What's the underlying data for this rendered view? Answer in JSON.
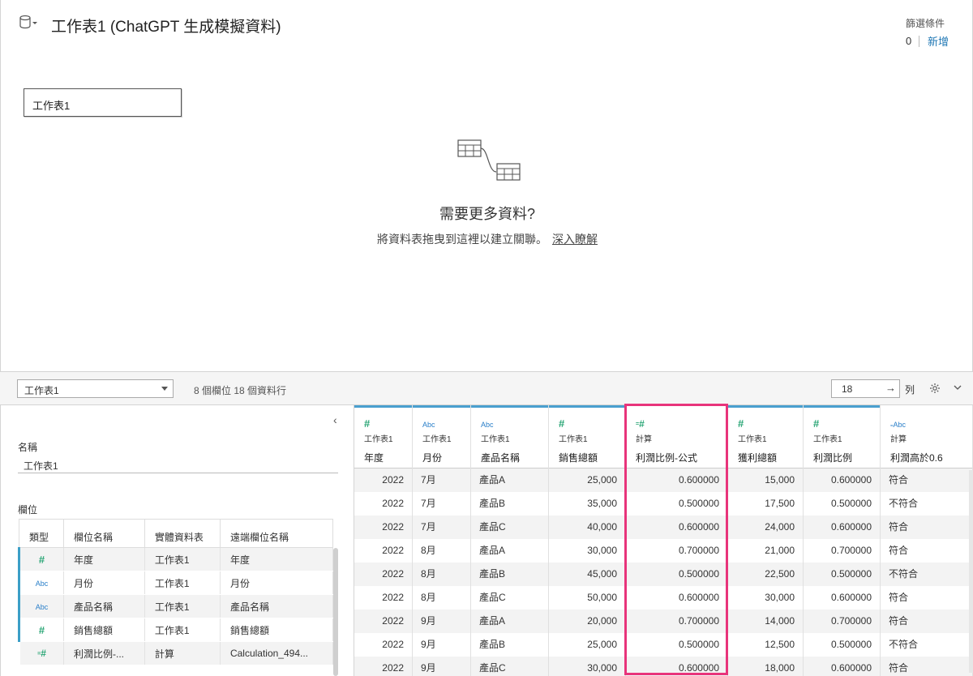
{
  "header": {
    "title": "工作表1 (ChatGPT 生成模擬資料)",
    "filter_label": "篩選條件",
    "filter_count": "0",
    "filter_add": "新增"
  },
  "canvas": {
    "table_chip": "工作表1",
    "need_more": "需要更多資料?",
    "drag_hint": "將資料表拖曳到這裡以建立關聯。",
    "learn_more": "深入瞭解"
  },
  "toolbar": {
    "table_select": "工作表1",
    "info": "8 個欄位 18 個資料行",
    "rows_value": "18",
    "rows_arrow": "→",
    "rows_label": "列"
  },
  "meta_panel": {
    "name_label": "名稱",
    "name_value": "工作表1",
    "fields_label": "欄位",
    "columns": [
      "類型",
      "欄位名稱",
      "實體資料表",
      "遠端欄位名稱"
    ],
    "rows": [
      {
        "type": "number",
        "icon": "#",
        "field": "年度",
        "table": "工作表1",
        "remote": "年度"
      },
      {
        "type": "string",
        "icon": "Abc",
        "field": "月份",
        "table": "工作表1",
        "remote": "月份"
      },
      {
        "type": "string",
        "icon": "Abc",
        "field": "產品名稱",
        "table": "工作表1",
        "remote": "產品名稱"
      },
      {
        "type": "number",
        "icon": "#",
        "field": "銷售總額",
        "table": "工作表1",
        "remote": "銷售總額"
      },
      {
        "type": "calc-number",
        "icon": "=#",
        "field": "利潤比例-...",
        "table": "計算",
        "remote": "Calculation_494..."
      }
    ]
  },
  "grid": {
    "columns": [
      {
        "type": "number",
        "icon": "#",
        "source": "工作表1",
        "name": "年度",
        "align": "num"
      },
      {
        "type": "string",
        "icon": "Abc",
        "source": "工作表1",
        "name": "月份",
        "align": "txt"
      },
      {
        "type": "string",
        "icon": "Abc",
        "source": "工作表1",
        "name": "產品名稱",
        "align": "txt"
      },
      {
        "type": "number",
        "icon": "#",
        "source": "工作表1",
        "name": "銷售總額",
        "align": "num"
      },
      {
        "type": "calc-number",
        "icon": "=#",
        "source": "計算",
        "name": "利潤比例-公式",
        "align": "num"
      },
      {
        "type": "number",
        "icon": "#",
        "source": "工作表1",
        "name": "獲利總額",
        "align": "num"
      },
      {
        "type": "number",
        "icon": "#",
        "source": "工作表1",
        "name": "利潤比例",
        "align": "num"
      },
      {
        "type": "calc-string",
        "icon": "=Abc",
        "source": "計算",
        "name": "利潤高於0.6",
        "align": "txt"
      }
    ],
    "rows": [
      [
        "2022",
        "7月",
        "產品A",
        "25,000",
        "0.600000",
        "15,000",
        "0.600000",
        "符合"
      ],
      [
        "2022",
        "7月",
        "產品B",
        "35,000",
        "0.500000",
        "17,500",
        "0.500000",
        "不符合"
      ],
      [
        "2022",
        "7月",
        "產品C",
        "40,000",
        "0.600000",
        "24,000",
        "0.600000",
        "符合"
      ],
      [
        "2022",
        "8月",
        "產品A",
        "30,000",
        "0.700000",
        "21,000",
        "0.700000",
        "符合"
      ],
      [
        "2022",
        "8月",
        "產品B",
        "45,000",
        "0.500000",
        "22,500",
        "0.500000",
        "不符合"
      ],
      [
        "2022",
        "8月",
        "產品C",
        "50,000",
        "0.600000",
        "30,000",
        "0.600000",
        "符合"
      ],
      [
        "2022",
        "9月",
        "產品A",
        "20,000",
        "0.700000",
        "14,000",
        "0.700000",
        "符合"
      ],
      [
        "2022",
        "9月",
        "產品B",
        "25,000",
        "0.500000",
        "12,500",
        "0.500000",
        "不符合"
      ],
      [
        "2022",
        "9月",
        "產品C",
        "30,000",
        "0.600000",
        "18,000",
        "0.600000",
        "符合"
      ]
    ]
  },
  "colors": {
    "accent_blue": "#1f77b4",
    "column_bar": "#4a9fcf",
    "highlight": "#e8347b",
    "number_icon": "#2aa676",
    "string_icon": "#2a7fc9"
  }
}
